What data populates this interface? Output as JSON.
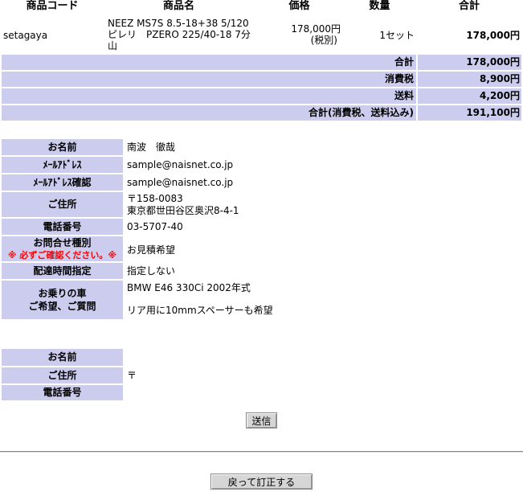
{
  "table_headers": [
    "商品コード",
    "商品名",
    "価格",
    "数量",
    "合計"
  ],
  "item": {
    "code": "setagaya",
    "name_line1": "NEEZ MS7S 8.5-18+38 5/120",
    "name_line2": "ピレリ　PZERO 225/40-18 7分",
    "name_line3": "山",
    "price": "178,000円",
    "price_note": "(税別)",
    "quantity": "1セット",
    "total": "178,000円"
  },
  "totals": [
    {
      "label": "合計",
      "value": "178,000円"
    },
    {
      "label": "消費税",
      "value": "8,900円"
    },
    {
      "label": "送料",
      "value": "4,200円"
    },
    {
      "label": "合計(消費税、送料込み)",
      "value": "191,100円"
    }
  ],
  "customer": {
    "name_label": "お名前",
    "name": "南波　徹哉",
    "email_label": "ﾒｰﾙｱﾄﾞﾚｽ",
    "email": "sample@naisnet.co.jp",
    "email_confirm_label": "ﾒｰﾙｱﾄﾞﾚｽ確認",
    "email_confirm": "sample@naisnet.co.jp",
    "address_label": "ご住所",
    "postal": "〒158-0083",
    "address": "東京都世田谷区奥沢8-4-1",
    "phone_label": "電話番号",
    "phone": "03-5707-40",
    "inquiry_label": "お問合せ種別",
    "inquiry_note": "※ 必ずご確認ください。※",
    "inquiry": "お見積希望",
    "delivery_label": "配達時間指定",
    "delivery": "指定しない",
    "car_label_1": "お乗りの車",
    "car_label_2": "ご希望、ご質問",
    "car": "BMW E46 330Ci 2002年式",
    "request": "リア用に10mmスペーサーも希望"
  },
  "shipping": {
    "name_label": "お名前",
    "name": "",
    "address_label": "ご住所",
    "postal": "〒",
    "phone_label": "電話番号",
    "phone": ""
  },
  "buttons": {
    "submit": "送信",
    "back": "戻って訂正する"
  }
}
